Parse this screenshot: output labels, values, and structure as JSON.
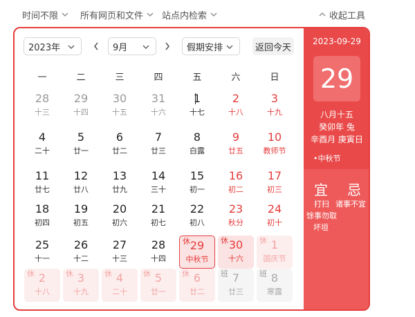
{
  "toolbar": {
    "time": "时间不限",
    "scope": "所有网页和文件",
    "site": "站点内检索",
    "collapse": "收起工具"
  },
  "controls": {
    "year": "2023年",
    "month": "9月",
    "holiday": "假期安排",
    "today": "返回今天"
  },
  "weekdays": [
    "一",
    "二",
    "三",
    "四",
    "五",
    "六",
    "日"
  ],
  "days": [
    {
      "n": "28",
      "s": "十三",
      "t": "other"
    },
    {
      "n": "29",
      "s": "十四",
      "t": "other"
    },
    {
      "n": "30",
      "s": "十五",
      "t": "other"
    },
    {
      "n": "31",
      "s": "十六",
      "t": "other"
    },
    {
      "n": "1",
      "s": "十七",
      "t": "normal",
      "caret": true
    },
    {
      "n": "2",
      "s": "十八",
      "t": "weekend"
    },
    {
      "n": "3",
      "s": "十九",
      "t": "weekend"
    },
    {
      "n": "4",
      "s": "二十",
      "t": "normal"
    },
    {
      "n": "5",
      "s": "廿一",
      "t": "normal"
    },
    {
      "n": "6",
      "s": "廿二",
      "t": "normal"
    },
    {
      "n": "7",
      "s": "廿三",
      "t": "normal"
    },
    {
      "n": "8",
      "s": "白露",
      "t": "normal"
    },
    {
      "n": "9",
      "s": "廿五",
      "t": "weekend"
    },
    {
      "n": "10",
      "s": "教师节",
      "t": "weekend"
    },
    {
      "n": "11",
      "s": "廿七",
      "t": "normal"
    },
    {
      "n": "12",
      "s": "廿八",
      "t": "normal"
    },
    {
      "n": "13",
      "s": "廿九",
      "t": "normal"
    },
    {
      "n": "14",
      "s": "三十",
      "t": "normal"
    },
    {
      "n": "15",
      "s": "初一",
      "t": "normal"
    },
    {
      "n": "16",
      "s": "初二",
      "t": "weekend"
    },
    {
      "n": "17",
      "s": "初三",
      "t": "weekend"
    },
    {
      "n": "18",
      "s": "初四",
      "t": "normal"
    },
    {
      "n": "19",
      "s": "初五",
      "t": "normal"
    },
    {
      "n": "20",
      "s": "初六",
      "t": "normal"
    },
    {
      "n": "21",
      "s": "初七",
      "t": "normal"
    },
    {
      "n": "22",
      "s": "初八",
      "t": "normal"
    },
    {
      "n": "23",
      "s": "秋分",
      "t": "weekend"
    },
    {
      "n": "24",
      "s": "初十",
      "t": "weekend"
    },
    {
      "n": "25",
      "s": "十一",
      "t": "normal"
    },
    {
      "n": "26",
      "s": "十二",
      "t": "normal"
    },
    {
      "n": "27",
      "s": "十三",
      "t": "normal"
    },
    {
      "n": "28",
      "s": "十四",
      "t": "normal"
    },
    {
      "n": "29",
      "s": "中秋节",
      "t": "hol",
      "b": "休",
      "selected": true
    },
    {
      "n": "30",
      "s": "十六",
      "t": "hol",
      "b": "休"
    },
    {
      "n": "1",
      "s": "国庆节",
      "t": "hol-faded",
      "b": "休"
    },
    {
      "n": "2",
      "s": "十八",
      "t": "hol-faded",
      "b": "休"
    },
    {
      "n": "3",
      "s": "十九",
      "t": "hol-faded",
      "b": "休"
    },
    {
      "n": "4",
      "s": "二十",
      "t": "hol-faded",
      "b": "休"
    },
    {
      "n": "5",
      "s": "廿一",
      "t": "hol-faded",
      "b": "休"
    },
    {
      "n": "6",
      "s": "廿二",
      "t": "hol-faded",
      "b": "休"
    },
    {
      "n": "7",
      "s": "廿三",
      "t": "work",
      "b": "班"
    },
    {
      "n": "8",
      "s": "寒露",
      "t": "work",
      "b": "班"
    }
  ],
  "side": {
    "date": "2023-09-29",
    "day": "29",
    "lunar": "八月十五",
    "year_gz": "癸卯年 兔",
    "month_day_gz": "辛酉月 庚寅日",
    "festival": "•中秋节",
    "yi_label": "宜",
    "ji_label": "忌",
    "yi_items": [
      "打扫",
      "馀事勿取",
      "坏垣"
    ],
    "ji_items": [
      "诸事不宜"
    ]
  },
  "colors": {
    "accent": "#e63b3b",
    "panel": "#e94949",
    "holiday_bg": "#fbe3e3"
  }
}
